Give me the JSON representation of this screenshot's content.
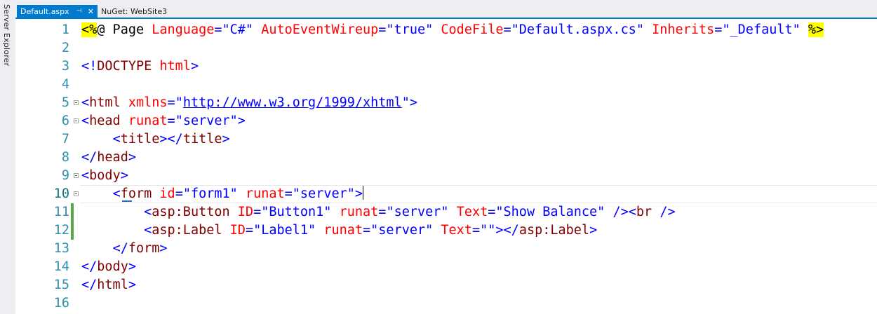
{
  "sidebar": {
    "label": "Server Explorer"
  },
  "tabs": [
    {
      "label": "Default.aspx",
      "pin": "⊣",
      "close": "✕",
      "active": true
    },
    {
      "label": "NuGet: WebSite3",
      "active": false
    }
  ],
  "lines": [
    {
      "num": "1",
      "tokens": [
        [
          "dir",
          "<%"
        ],
        [
          "text",
          "@ Page "
        ],
        [
          "attr",
          "Language"
        ],
        [
          "delim",
          "="
        ],
        [
          "val",
          "\"C#\""
        ],
        [
          "text",
          " "
        ],
        [
          "attr",
          "AutoEventWireup"
        ],
        [
          "delim",
          "="
        ],
        [
          "val",
          "\"true\""
        ],
        [
          "text",
          " "
        ],
        [
          "attr",
          "CodeFile"
        ],
        [
          "delim",
          "="
        ],
        [
          "val",
          "\"Default.aspx.cs\""
        ],
        [
          "text",
          " "
        ],
        [
          "attr",
          "Inherits"
        ],
        [
          "delim",
          "="
        ],
        [
          "val",
          "\"_Default\""
        ],
        [
          "text",
          " "
        ],
        [
          "dir",
          "%>"
        ]
      ]
    },
    {
      "num": "2",
      "tokens": []
    },
    {
      "num": "3",
      "tokens": [
        [
          "delim",
          "<!"
        ],
        [
          "tag",
          "DOCTYPE"
        ],
        [
          "text",
          " "
        ],
        [
          "attr",
          "html"
        ],
        [
          "delim",
          ">"
        ]
      ]
    },
    {
      "num": "4",
      "tokens": []
    },
    {
      "num": "5",
      "fold": true,
      "tokens": [
        [
          "delim",
          "<"
        ],
        [
          "tag",
          "html"
        ],
        [
          "text",
          " "
        ],
        [
          "attr",
          "xmlns"
        ],
        [
          "delim",
          "="
        ],
        [
          "val",
          "\""
        ],
        [
          "link",
          "http://www.w3.org/1999/xhtml"
        ],
        [
          "val",
          "\""
        ],
        [
          "delim",
          ">"
        ]
      ]
    },
    {
      "num": "6",
      "fold": true,
      "tokens": [
        [
          "delim",
          "<"
        ],
        [
          "tag",
          "head"
        ],
        [
          "text",
          " "
        ],
        [
          "attr",
          "runat"
        ],
        [
          "delim",
          "="
        ],
        [
          "val",
          "\"server\""
        ],
        [
          "delim",
          ">"
        ]
      ]
    },
    {
      "num": "7",
      "tokens": [
        [
          "text",
          "    "
        ],
        [
          "delim",
          "<"
        ],
        [
          "tag",
          "title"
        ],
        [
          "delim",
          "></"
        ],
        [
          "tag",
          "title"
        ],
        [
          "delim",
          ">"
        ]
      ]
    },
    {
      "num": "8",
      "tokens": [
        [
          "delim",
          "</"
        ],
        [
          "tag",
          "head"
        ],
        [
          "delim",
          ">"
        ]
      ]
    },
    {
      "num": "9",
      "fold": true,
      "tokens": [
        [
          "delim",
          "<"
        ],
        [
          "tag",
          "body"
        ],
        [
          "delim",
          ">"
        ]
      ]
    },
    {
      "num": "10",
      "fold": true,
      "current": true,
      "tokens": [
        [
          "text",
          "    "
        ],
        [
          "delim",
          "<"
        ],
        [
          "tag",
          "form"
        ],
        [
          "text",
          " "
        ],
        [
          "attr",
          "id"
        ],
        [
          "delim",
          "="
        ],
        [
          "val",
          "\"form1\""
        ],
        [
          "text",
          " "
        ],
        [
          "attr",
          "runat"
        ],
        [
          "delim",
          "="
        ],
        [
          "val",
          "\"server\""
        ],
        [
          "delim",
          ">"
        ],
        [
          "caret",
          ""
        ]
      ]
    },
    {
      "num": "11",
      "changed": true,
      "tokens": [
        [
          "text",
          "        "
        ],
        [
          "delim",
          "<"
        ],
        [
          "tag",
          "asp:Button"
        ],
        [
          "text",
          " "
        ],
        [
          "attr",
          "ID"
        ],
        [
          "delim",
          "="
        ],
        [
          "val",
          "\"Button1\""
        ],
        [
          "text",
          " "
        ],
        [
          "attr",
          "runat"
        ],
        [
          "delim",
          "="
        ],
        [
          "val",
          "\"server\""
        ],
        [
          "text",
          " "
        ],
        [
          "attr",
          "Text"
        ],
        [
          "delim",
          "="
        ],
        [
          "val",
          "\"Show Balance\""
        ],
        [
          "text",
          " "
        ],
        [
          "delim",
          "/><"
        ],
        [
          "tag",
          "br"
        ],
        [
          "text",
          " "
        ],
        [
          "delim",
          "/>"
        ]
      ]
    },
    {
      "num": "12",
      "changed": true,
      "tokens": [
        [
          "text",
          "        "
        ],
        [
          "delim",
          "<"
        ],
        [
          "tag",
          "asp:Label"
        ],
        [
          "text",
          " "
        ],
        [
          "attr",
          "ID"
        ],
        [
          "delim",
          "="
        ],
        [
          "val",
          "\"Label1\""
        ],
        [
          "text",
          " "
        ],
        [
          "attr",
          "runat"
        ],
        [
          "delim",
          "="
        ],
        [
          "val",
          "\"server\""
        ],
        [
          "text",
          " "
        ],
        [
          "attr",
          "Text"
        ],
        [
          "delim",
          "="
        ],
        [
          "val",
          "\"\""
        ],
        [
          "delim",
          "></"
        ],
        [
          "tag",
          "asp:Label"
        ],
        [
          "delim",
          ">"
        ]
      ]
    },
    {
      "num": "13",
      "tokens": [
        [
          "text",
          "    "
        ],
        [
          "delim",
          "</"
        ],
        [
          "tag",
          "form"
        ],
        [
          "delim",
          ">"
        ]
      ]
    },
    {
      "num": "14",
      "tokens": [
        [
          "delim",
          "</"
        ],
        [
          "tag",
          "body"
        ],
        [
          "delim",
          ">"
        ]
      ]
    },
    {
      "num": "15",
      "tokens": [
        [
          "delim",
          "</"
        ],
        [
          "tag",
          "html"
        ],
        [
          "delim",
          ">"
        ]
      ]
    },
    {
      "num": "16",
      "tokens": []
    }
  ],
  "colors": {
    "tab_active": "#007acc",
    "line_number": "#2b91af",
    "tag": "#800000",
    "attribute": "#ff0000",
    "value": "#0000ff",
    "directive_highlight": "#ffff00",
    "change_marker": "#57a64a"
  }
}
